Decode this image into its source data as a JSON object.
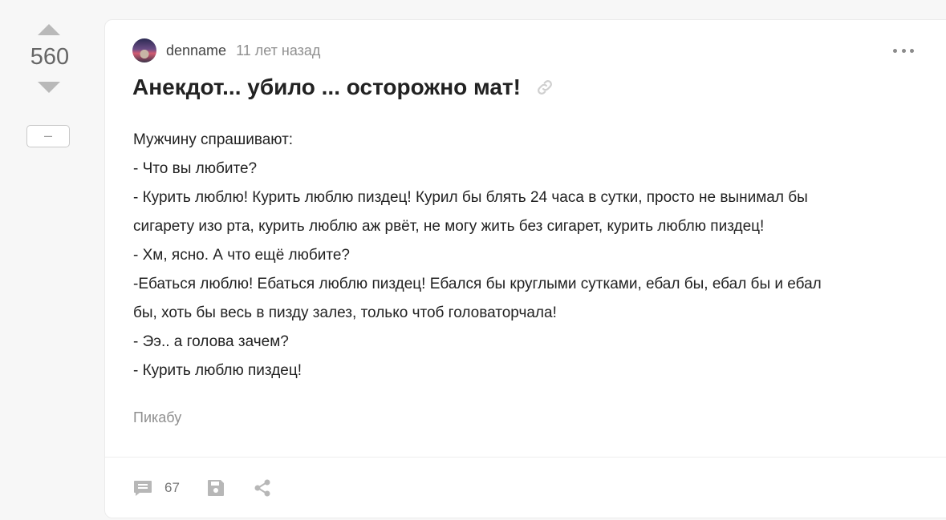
{
  "vote": {
    "count": "560",
    "collapse_label": "–"
  },
  "post": {
    "author": "denname",
    "time": "11 лет назад",
    "title": "Анекдот... убило ... осторожно мат!",
    "lines": [
      "Мужчину спрашивают:",
      "- Что вы любите?",
      "- Курить люблю! Курить люблю пиздец! Курил бы блять 24 часа в сутки, просто не вынимал бы",
      "сигарету изо рта, курить люблю аж рвёт, не могу жить без сигарет, курить люблю пиздец!",
      "- Хм, ясно. А что ещё любите?",
      "-Ебаться люблю! Ебаться люблю пиздец! Ебался бы круглыми сутками, ебал бы, ебал бы и ебал",
      "бы, хоть бы весь в пизду залез, только чтоб головаторчала!",
      "- Ээ.. а голова зачем?",
      "- Курить люблю пиздец!"
    ],
    "source": "Пикабу"
  },
  "footer": {
    "comments_count": "67"
  },
  "icons": {
    "link": "link-icon",
    "comments": "comment-icon",
    "save": "save-icon",
    "share": "share-icon",
    "more": "more-options-icon"
  },
  "colors": {
    "icon_gray": "#b7b7b7",
    "text_muted": "#8f8f8f",
    "background": "#f7f7f7"
  }
}
